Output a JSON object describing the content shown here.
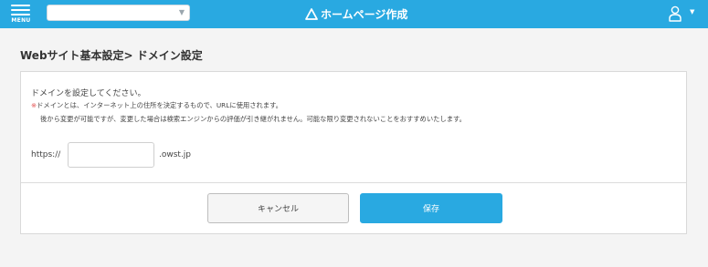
{
  "header": {
    "menu_label": "MENU",
    "site_select_value": "",
    "brand_title": "ホームページ作成",
    "brand_icon": "triangle-logo-icon",
    "user_icon": "user-icon",
    "user_caret_icon": "caret-down-icon",
    "accent_color": "#29a9e1"
  },
  "page": {
    "title": "Webサイト基本設定> ドメイン設定"
  },
  "form": {
    "intro": "ドメインを設定してください。",
    "note_mark": "※",
    "note_line1": "ドメインとは、インターネット上の住所を決定するもので、URLに使用されます。",
    "note_line2": "後から変更が可能ですが、変更した場合は検索エンジンからの評価が引き継がれません。可能な限り変更されないことをおすすめいたします。",
    "prefix": "https://",
    "domain_value": "",
    "domain_placeholder": "",
    "suffix": ".owst.jp"
  },
  "buttons": {
    "cancel": "キャンセル",
    "save": "保存"
  }
}
